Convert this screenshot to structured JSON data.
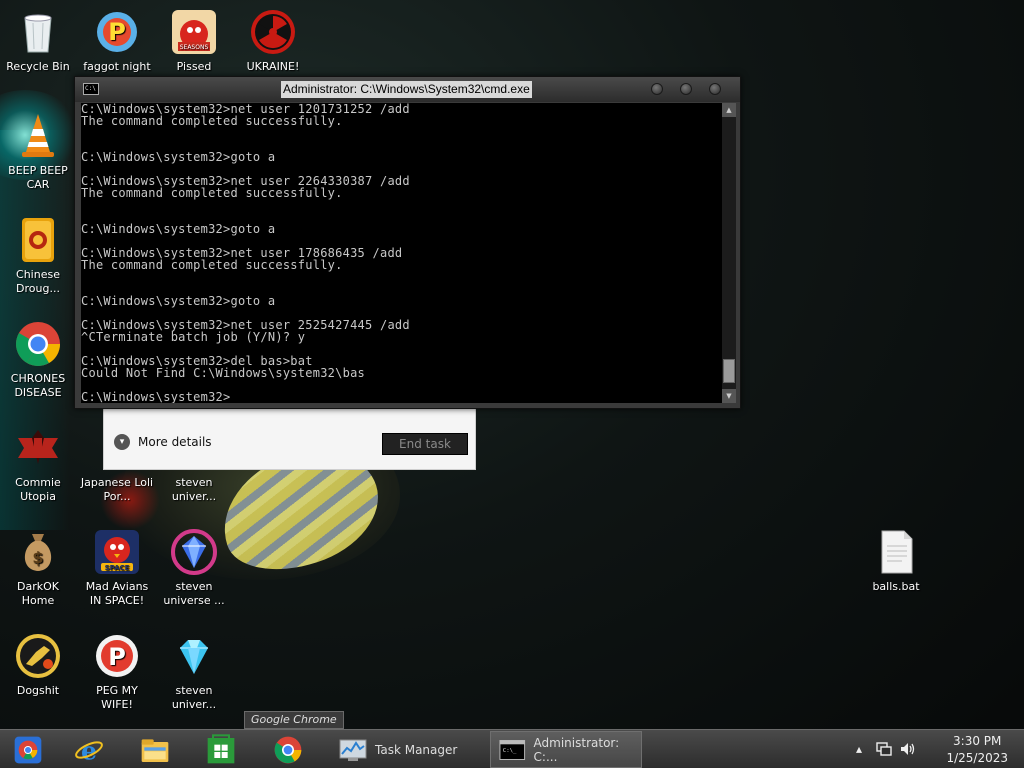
{
  "desktop_icons": [
    {
      "label": "Recycle Bin",
      "icon": "recycle-bin-icon"
    },
    {
      "label": "faggot night",
      "icon": "p-app-icon"
    },
    {
      "label": "Pissed",
      "icon": "angry-birds-seasons-icon"
    },
    {
      "label": "UKRAINE!",
      "icon": "radiation-icon"
    },
    {
      "label": "BEEP BEEP CAR",
      "icon": "vlc-cone-icon"
    },
    {
      "label": "Chinese Droug...",
      "icon": "mahjong-icon"
    },
    {
      "label": "CHRONES DISEASE",
      "icon": "chrome-icon"
    },
    {
      "label": "Commie Utopia",
      "icon": "papers-please-icon"
    },
    {
      "label": "Japanese Loli Por...",
      "icon": "japanese-shortcut-icon"
    },
    {
      "label": "steven univer...",
      "icon": "steven-universe-icon"
    },
    {
      "label": "DarkOK Home",
      "icon": "money-bag-icon"
    },
    {
      "label": "Mad Avians IN SPACE!",
      "icon": "angry-birds-space-icon"
    },
    {
      "label": "steven universe ...",
      "icon": "gem-ring-icon"
    },
    {
      "label": "Dogshit",
      "icon": "dog-icon"
    },
    {
      "label": "PEG MY WIFE!",
      "icon": "p-app-icon"
    },
    {
      "label": "steven univer...",
      "icon": "blue-diamond-icon"
    },
    {
      "label": "balls.bat",
      "icon": "batch-file-icon"
    }
  ],
  "task_manager": {
    "more_details": "More details",
    "end_task": "End task"
  },
  "cmd": {
    "title": "Administrator: C:\\Windows\\System32\\cmd.exe",
    "lines": [
      "C:\\Windows\\system32>net user 1201731252 /add",
      "The command completed successfully.",
      "",
      "",
      "C:\\Windows\\system32>goto a",
      "",
      "C:\\Windows\\system32>net user 2264330387 /add",
      "The command completed successfully.",
      "",
      "",
      "C:\\Windows\\system32>goto a",
      "",
      "C:\\Windows\\system32>net user 178686435 /add",
      "The command completed successfully.",
      "",
      "",
      "C:\\Windows\\system32>goto a",
      "",
      "C:\\Windows\\system32>net user 2525427445 /add",
      "^CTerminate batch job (Y/N)? y",
      "",
      "C:\\Windows\\system32>del bas>bat",
      "Could Not Find C:\\Windows\\system32\\bas",
      "",
      "C:\\Windows\\system32>"
    ]
  },
  "tooltip": "Google Chrome",
  "taskbar": {
    "pinned": [
      "chrome-icon",
      "internet-explorer-icon",
      "file-explorer-icon",
      "windows-store-icon",
      "chrome-icon"
    ],
    "apps": [
      {
        "label": "Task Manager",
        "icon": "task-manager-icon"
      },
      {
        "label": "Administrator: C:...",
        "icon": "cmd-icon"
      }
    ],
    "time": "3:30 PM",
    "date": "1/25/2023"
  },
  "colors": {
    "cmd_text": "#c8c8c8",
    "cmd_bg": "#000000",
    "taskbar": "#3a3a3a"
  }
}
